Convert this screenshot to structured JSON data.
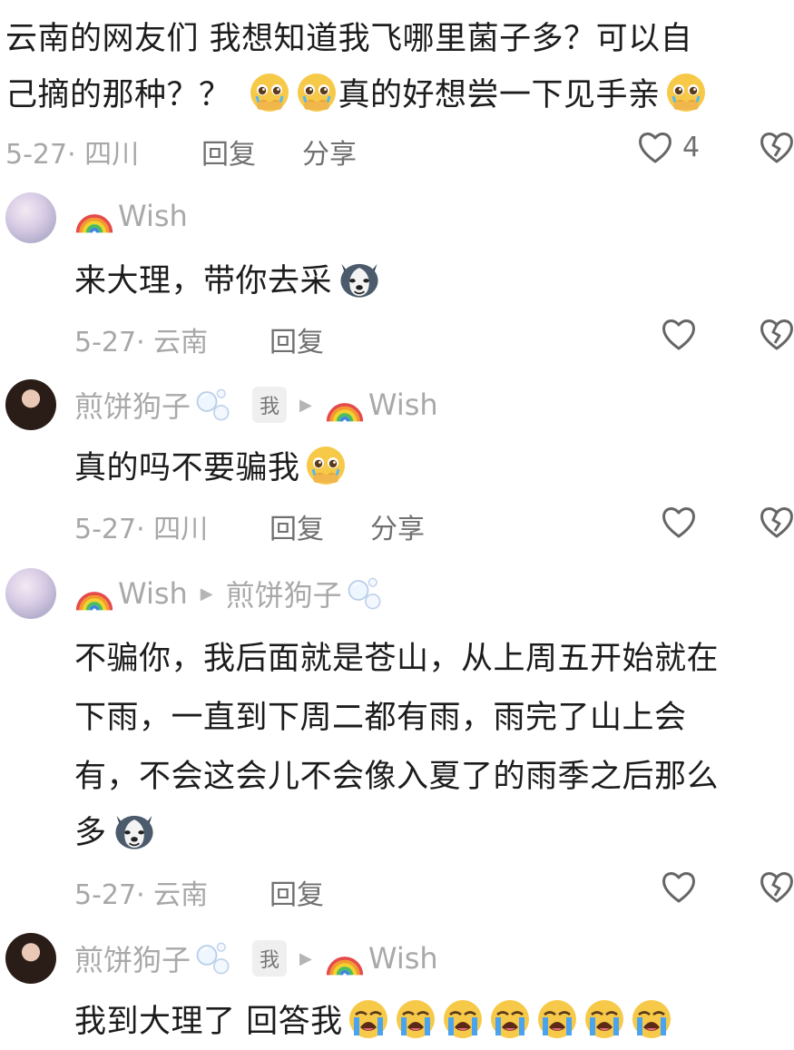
{
  "top_comment": {
    "line1": "云南的网友们 我想知道我飞哪里菌子多？可以自",
    "line2": "己摘的那种？？",
    "line2_tail": "真的好想尝一下见手亲",
    "meta": "5-27· 四川",
    "reply": "回复",
    "share": "分享",
    "like_count": "4"
  },
  "replies": [
    {
      "user": "Wish",
      "text": "来大理，带你去采",
      "meta": "5-27· 云南",
      "reply": "回复"
    },
    {
      "user": "煎饼狗子",
      "me_badge": "我",
      "to": "Wish",
      "text": "真的吗不要骗我",
      "meta": "5-27· 四川",
      "reply": "回复",
      "share": "分享"
    },
    {
      "user": "Wish",
      "to": "煎饼狗子",
      "lines": [
        "不骗你，我后面就是苍山，从上周五开始就在",
        "下雨，一直到下周二都有雨，雨完了山上会",
        "有，不会这会儿不会像入夏了的雨季之后那么",
        "多"
      ],
      "meta": "5-27· 云南",
      "reply": "回复"
    },
    {
      "user": "煎饼狗子",
      "me_badge": "我",
      "to": "Wish",
      "text": "我到大理了 回答我"
    }
  ],
  "icons": {
    "like": "heart-outline-icon",
    "dislike": "broken-heart-icon",
    "pleading": "pleading-face-emoji",
    "husky": "husky-dog-emoji",
    "crying": "loudly-crying-face-emoji",
    "rainbow": "rainbow-emoji",
    "bubbles": "bubbles-emoji"
  }
}
